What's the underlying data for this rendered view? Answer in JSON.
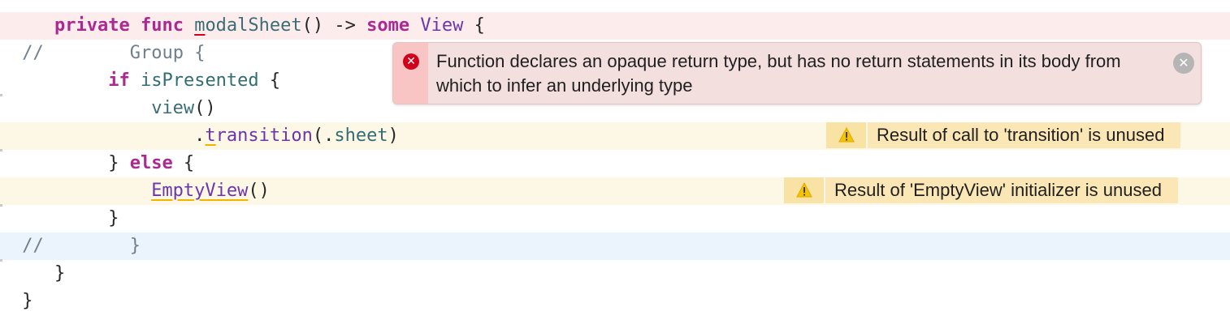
{
  "editor": {
    "lines": [
      {
        "t": [
          {
            "s": "    "
          },
          {
            "s": "private",
            "c": "kw"
          },
          {
            "s": " "
          },
          {
            "s": "func",
            "c": "kw"
          },
          {
            "s": " "
          },
          {
            "s": "m",
            "c": "fn ul-red"
          },
          {
            "s": "odalSheet",
            "c": "fn"
          },
          {
            "s": "() -> "
          },
          {
            "s": "some",
            "c": "kw"
          },
          {
            "s": " "
          },
          {
            "s": "View",
            "c": "ty"
          },
          {
            "s": " {"
          }
        ]
      },
      {
        "t": [
          {
            "s": " //",
            "c": "cm"
          },
          {
            "s": "        "
          },
          {
            "s": "Group {",
            "c": "cm"
          }
        ]
      },
      {
        "t": [
          {
            "s": "         "
          },
          {
            "s": "if",
            "c": "kw"
          },
          {
            "s": " "
          },
          {
            "s": "isPresented",
            "c": "id"
          },
          {
            "s": " {"
          }
        ]
      },
      {
        "t": [
          {
            "s": "             "
          },
          {
            "s": "view",
            "c": "fn"
          },
          {
            "s": "()"
          }
        ]
      },
      {
        "t": [
          {
            "s": "                 ."
          },
          {
            "s": "t",
            "c": "ty ul-yel"
          },
          {
            "s": "ransition",
            "c": "ty"
          },
          {
            "s": "(."
          },
          {
            "s": "sheet",
            "c": "id"
          },
          {
            "s": ")"
          }
        ]
      },
      {
        "t": [
          {
            "s": "         } "
          },
          {
            "s": "else",
            "c": "kw"
          },
          {
            "s": " {"
          }
        ]
      },
      {
        "t": [
          {
            "s": "             "
          },
          {
            "s": "EmptyView",
            "c": "ty ul-yel"
          },
          {
            "s": "()"
          }
        ]
      },
      {
        "t": [
          {
            "s": "         }"
          }
        ]
      },
      {
        "t": [
          {
            "s": " //",
            "c": "cm"
          },
          {
            "s": "        "
          },
          {
            "s": "}",
            "c": "cm"
          }
        ]
      },
      {
        "t": [
          {
            "s": "    }"
          }
        ]
      },
      {
        "t": [
          {
            "s": " }"
          }
        ]
      }
    ]
  },
  "error": {
    "icon": "error-x-icon",
    "message": "Function declares an opaque return type, but has no return statements in its body from which to infer an underlying type",
    "close_icon": "close-icon"
  },
  "warnings": [
    {
      "icon": "warning-triangle-icon",
      "text": "Result of call to 'transition' is unused"
    },
    {
      "icon": "warning-triangle-icon",
      "text": "Result of 'EmptyView' initializer is unused"
    }
  ],
  "colors": {
    "error_line": "#fcecec",
    "warning_line": "#fdf7e6",
    "selected_line": "#ebf3fd",
    "error_icon": "#d0021b",
    "warning_badge": "#fbe7b5"
  }
}
